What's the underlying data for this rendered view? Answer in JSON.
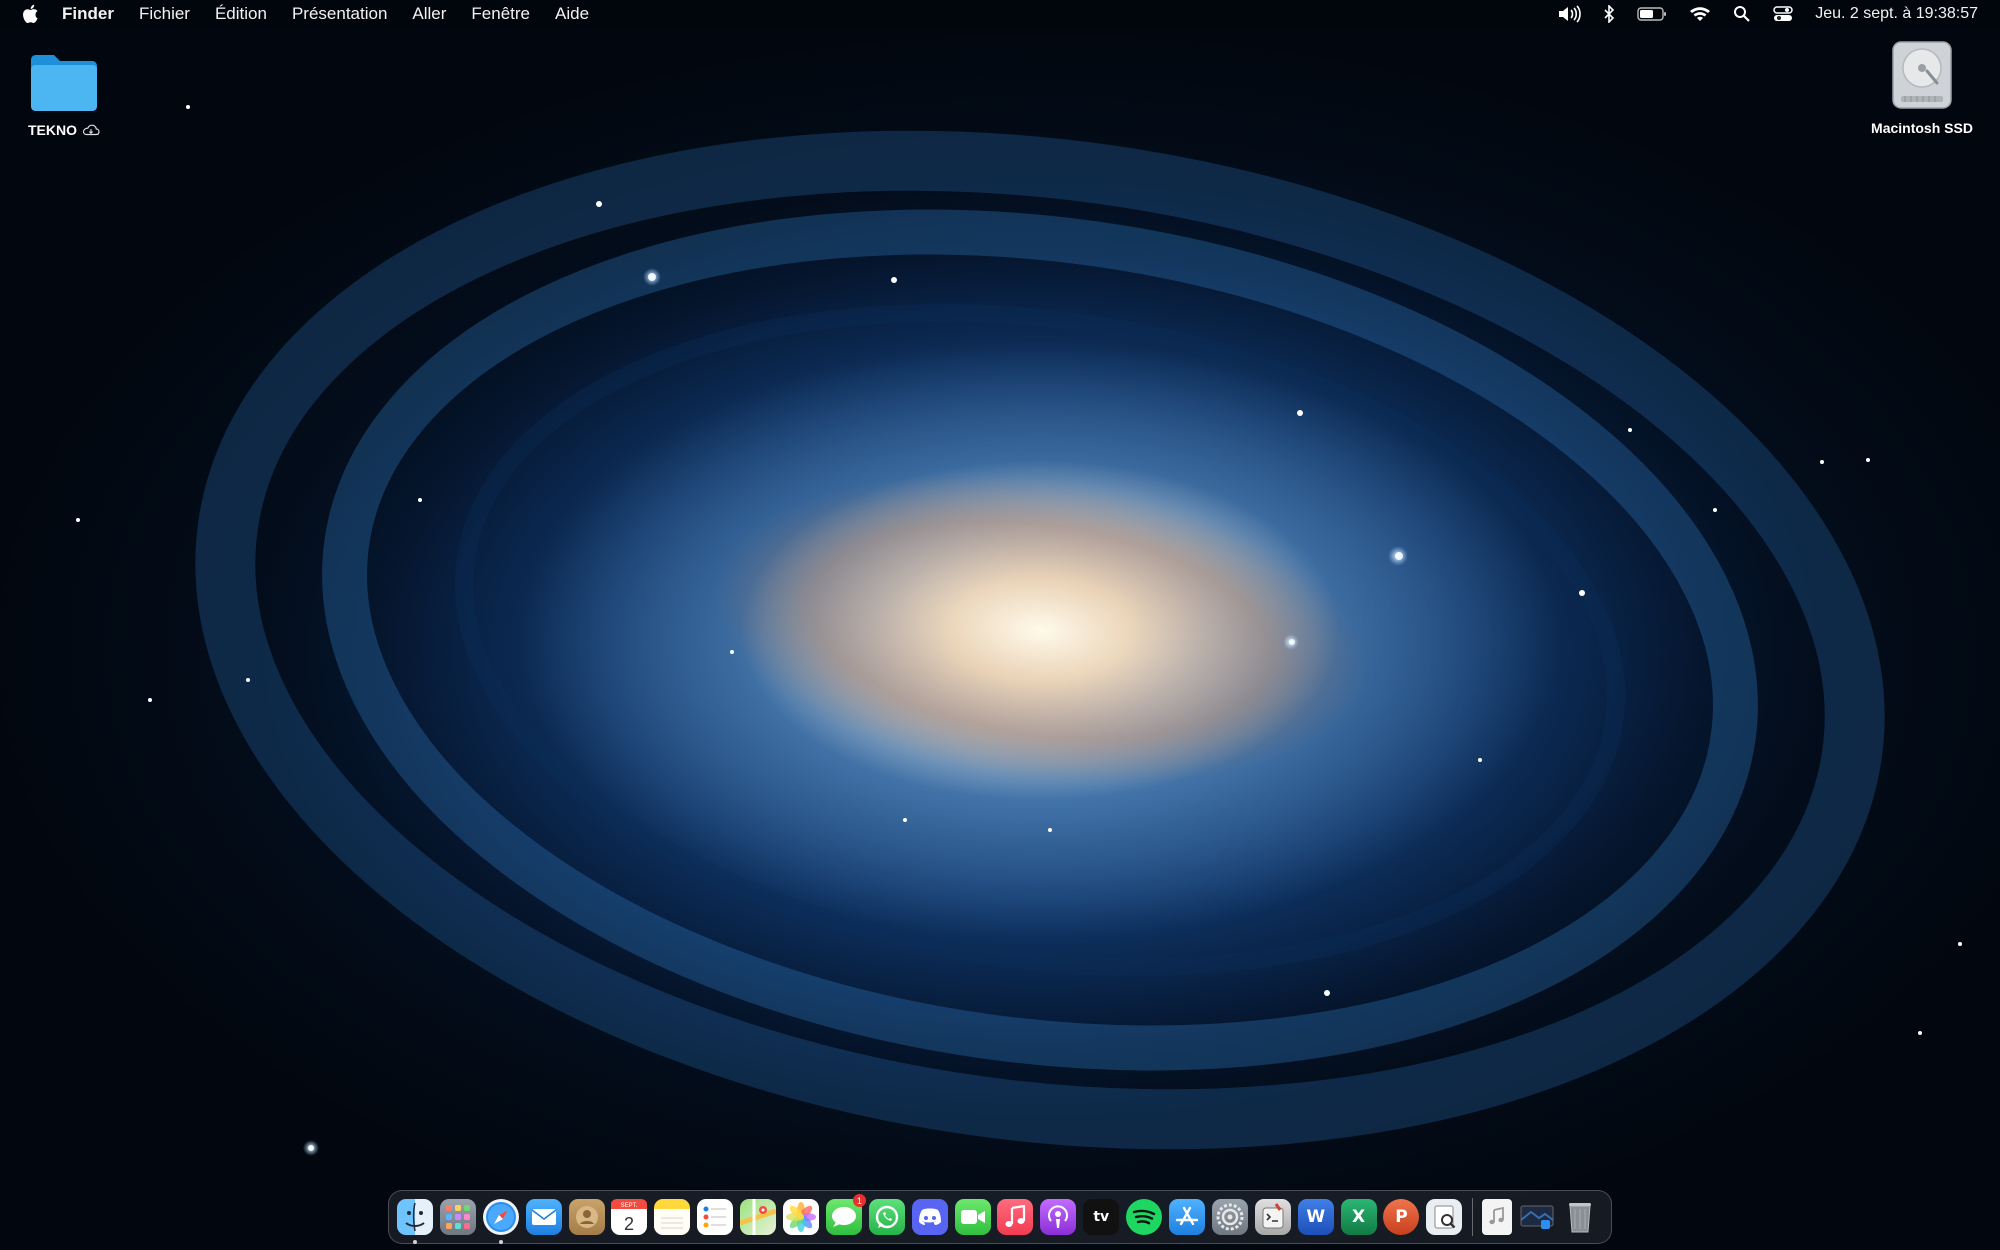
{
  "menubar": {
    "app_name": "Finder",
    "menus": [
      "Fichier",
      "Édition",
      "Présentation",
      "Aller",
      "Fenêtre",
      "Aide"
    ],
    "clock": "Jeu. 2 sept. à  19:38:57",
    "status_icons": [
      "volume-icon",
      "bluetooth-icon",
      "battery-icon",
      "wifi-icon",
      "spotlight-icon",
      "control-center-icon"
    ]
  },
  "desktop": {
    "folder_label": "TEKNO",
    "drive_label": "Macintosh SSD"
  },
  "dock": {
    "apps": [
      {
        "name": "Finder",
        "icon": "finder-icon",
        "running": true
      },
      {
        "name": "Launchpad",
        "icon": "launchpad-icon"
      },
      {
        "name": "Safari",
        "icon": "safari-icon",
        "running": true
      },
      {
        "name": "Mail",
        "icon": "mail-icon"
      },
      {
        "name": "Contacts",
        "icon": "contacts-icon"
      },
      {
        "name": "Calendar",
        "icon": "calendar-icon",
        "month": "SEPT.",
        "day": "2"
      },
      {
        "name": "Notes",
        "icon": "notes-icon"
      },
      {
        "name": "Reminders",
        "icon": "reminders-icon"
      },
      {
        "name": "Maps",
        "icon": "maps-icon"
      },
      {
        "name": "Photos",
        "icon": "photos-icon"
      },
      {
        "name": "Messages",
        "icon": "messages-icon",
        "badge": "1"
      },
      {
        "name": "WhatsApp",
        "icon": "whatsapp-icon"
      },
      {
        "name": "Discord",
        "icon": "discord-icon"
      },
      {
        "name": "FaceTime",
        "icon": "facetime-icon"
      },
      {
        "name": "Music",
        "icon": "music-icon"
      },
      {
        "name": "Podcasts",
        "icon": "podcasts-icon"
      },
      {
        "name": "TV",
        "icon": "appletv-icon",
        "text": "tv"
      },
      {
        "name": "Spotify",
        "icon": "spotify-icon"
      },
      {
        "name": "App Store",
        "icon": "appstore-icon"
      },
      {
        "name": "System Preferences",
        "icon": "system-preferences-icon"
      },
      {
        "name": "Script Editor",
        "icon": "script-editor-icon"
      },
      {
        "name": "Microsoft Word",
        "icon": "word-icon",
        "text": "W"
      },
      {
        "name": "Microsoft Excel",
        "icon": "excel-icon",
        "text": "X"
      },
      {
        "name": "Microsoft PowerPoint",
        "icon": "powerpoint-icon",
        "text": "P"
      },
      {
        "name": "Preview",
        "icon": "preview-icon"
      }
    ],
    "right": [
      {
        "name": "Audio file",
        "icon": "audio-file-icon"
      },
      {
        "name": "Screenshot",
        "icon": "screenshot-stack-icon"
      },
      {
        "name": "Trash",
        "icon": "trash-icon"
      }
    ]
  },
  "colors": {
    "background": "#02070f",
    "galaxy_blue": "#1e64b0",
    "galaxy_core": "#fff6e6"
  }
}
